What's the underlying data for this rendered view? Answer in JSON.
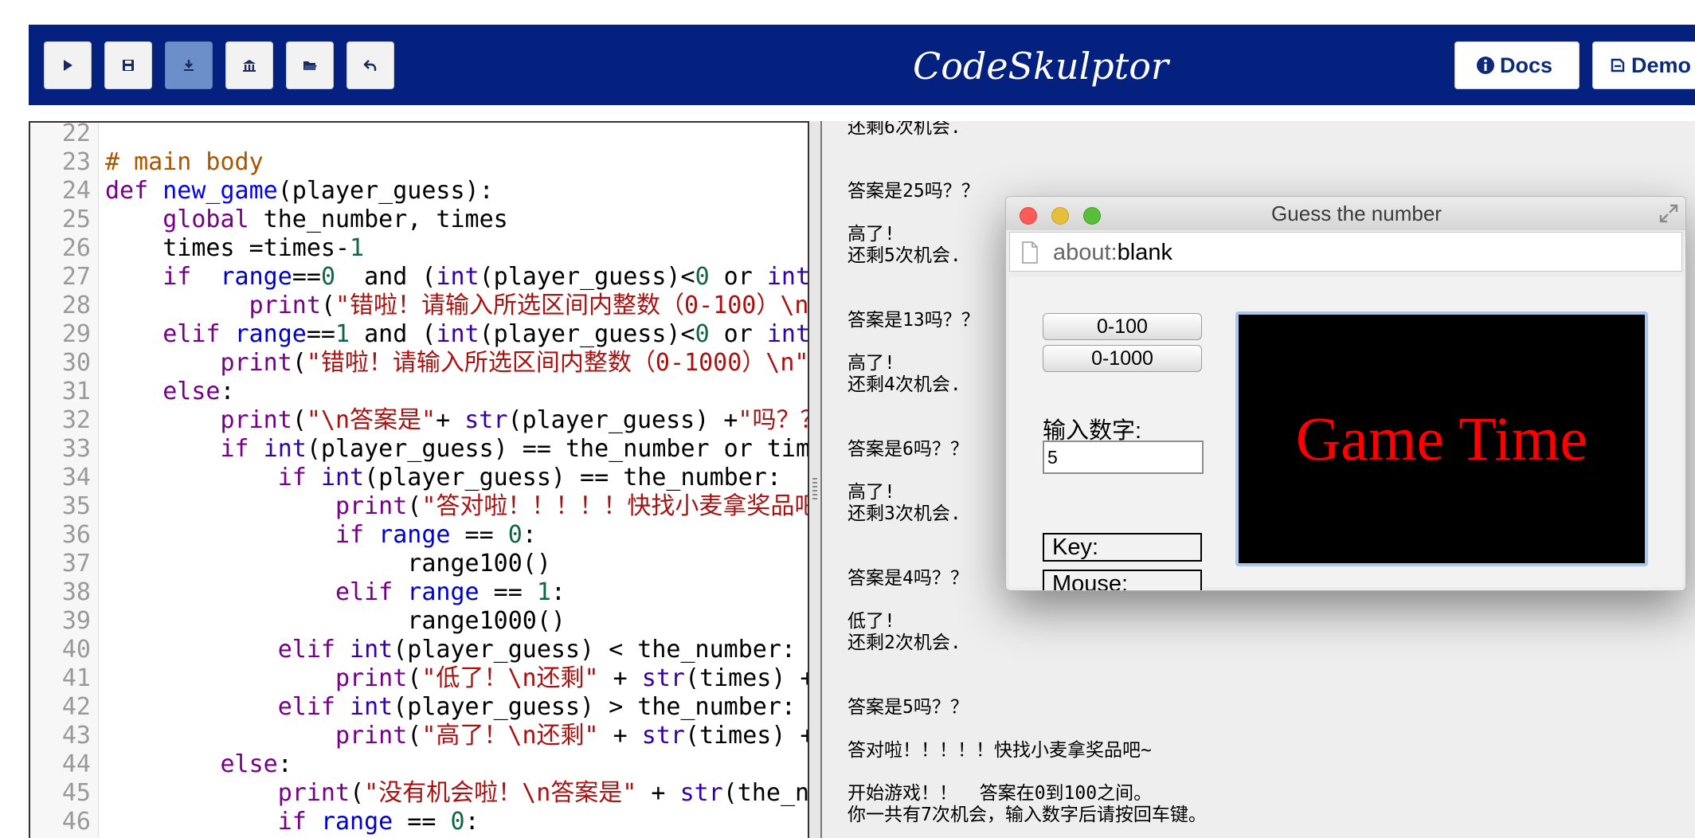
{
  "header": {
    "toolbar_buttons": [
      {
        "icon": "play-icon"
      },
      {
        "icon": "save-icon"
      },
      {
        "icon": "download-icon"
      },
      {
        "icon": "archive-icon"
      },
      {
        "icon": "open-folder-icon"
      },
      {
        "icon": "undo-icon"
      }
    ],
    "title": "CodeSkulptor",
    "docs_label": "Docs",
    "demos_label": "Demo"
  },
  "editor": {
    "line_numbers": [
      "22",
      "23",
      "24",
      "25",
      "26",
      "27",
      "28",
      "29",
      "30",
      "31",
      "32",
      "33",
      "34",
      "35",
      "36",
      "37",
      "38",
      "39",
      "40",
      "41",
      "42",
      "43",
      "44",
      "45",
      "46"
    ]
  },
  "console": {
    "lines": [
      "还剩6次机会.",
      "",
      "答案是25吗？？",
      "",
      "高了!",
      "还剩5次机会.",
      "",
      "答案是13吗？？",
      "",
      "高了!",
      "还剩4次机会.",
      "",
      "答案是6吗？？",
      "",
      "高了!",
      "还剩3次机会.",
      "",
      "答案是4吗？？",
      "",
      "低了!",
      "还剩2次机会.",
      "",
      "答案是5吗？？",
      "",
      "答对啦！！！！！快找小麦拿奖品吧~",
      "",
      "开始游戏！！  答案在0到100之间。",
      "你一共有7次机会，输入数字后请按回车键。"
    ]
  },
  "popup": {
    "title": "Guess the number",
    "url_scheme": "about:",
    "url_path": "blank",
    "range_button_1": "0-100",
    "range_button_2": "0-1000",
    "input_label": "输入数字:",
    "input_value": "5",
    "key_label": "Key:",
    "mouse_label": "Mouse:",
    "canvas_text": "Game Time"
  },
  "colors": {
    "header_bg": "#04217f",
    "console_bg": "#eeeeee",
    "canvas_bg": "#000000",
    "canvas_text": "#ff0000"
  }
}
